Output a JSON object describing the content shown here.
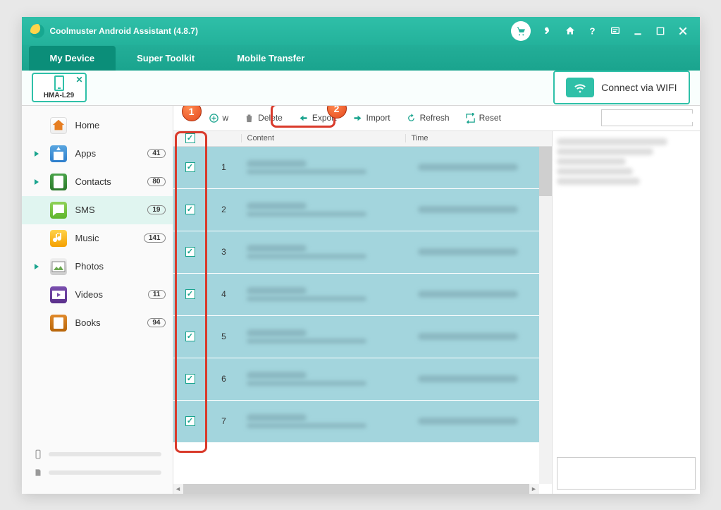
{
  "window": {
    "title": "Coolmuster Android Assistant (4.8.7)"
  },
  "tabs": [
    {
      "label": "My Device",
      "active": true
    },
    {
      "label": "Super Toolkit",
      "active": false
    },
    {
      "label": "Mobile Transfer",
      "active": false
    }
  ],
  "device": {
    "name": "HMA-L29"
  },
  "wifi_button": "Connect via WIFI",
  "sidebar": {
    "items": [
      {
        "key": "home",
        "label": "Home",
        "badge": "",
        "arrow": false,
        "active": false
      },
      {
        "key": "apps",
        "label": "Apps",
        "badge": "41",
        "arrow": true,
        "active": false
      },
      {
        "key": "contacts",
        "label": "Contacts",
        "badge": "80",
        "arrow": true,
        "active": false
      },
      {
        "key": "sms",
        "label": "SMS",
        "badge": "19",
        "arrow": false,
        "active": true
      },
      {
        "key": "music",
        "label": "Music",
        "badge": "141",
        "arrow": false,
        "active": false
      },
      {
        "key": "photos",
        "label": "Photos",
        "badge": "",
        "arrow": true,
        "active": false
      },
      {
        "key": "videos",
        "label": "Videos",
        "badge": "11",
        "arrow": false,
        "active": false
      },
      {
        "key": "books",
        "label": "Books",
        "badge": "94",
        "arrow": false,
        "active": false
      }
    ]
  },
  "toolbar": {
    "new": "w",
    "delete": "Delete",
    "export": "Export",
    "import": "Import",
    "refresh": "Refresh",
    "reset": "Reset"
  },
  "columns": {
    "content": "Content",
    "time": "Time"
  },
  "rows": [
    {
      "num": "1"
    },
    {
      "num": "2"
    },
    {
      "num": "3"
    },
    {
      "num": "4"
    },
    {
      "num": "5"
    },
    {
      "num": "6"
    },
    {
      "num": "7"
    }
  ],
  "annotations": {
    "marker1": "1",
    "marker2": "2"
  }
}
